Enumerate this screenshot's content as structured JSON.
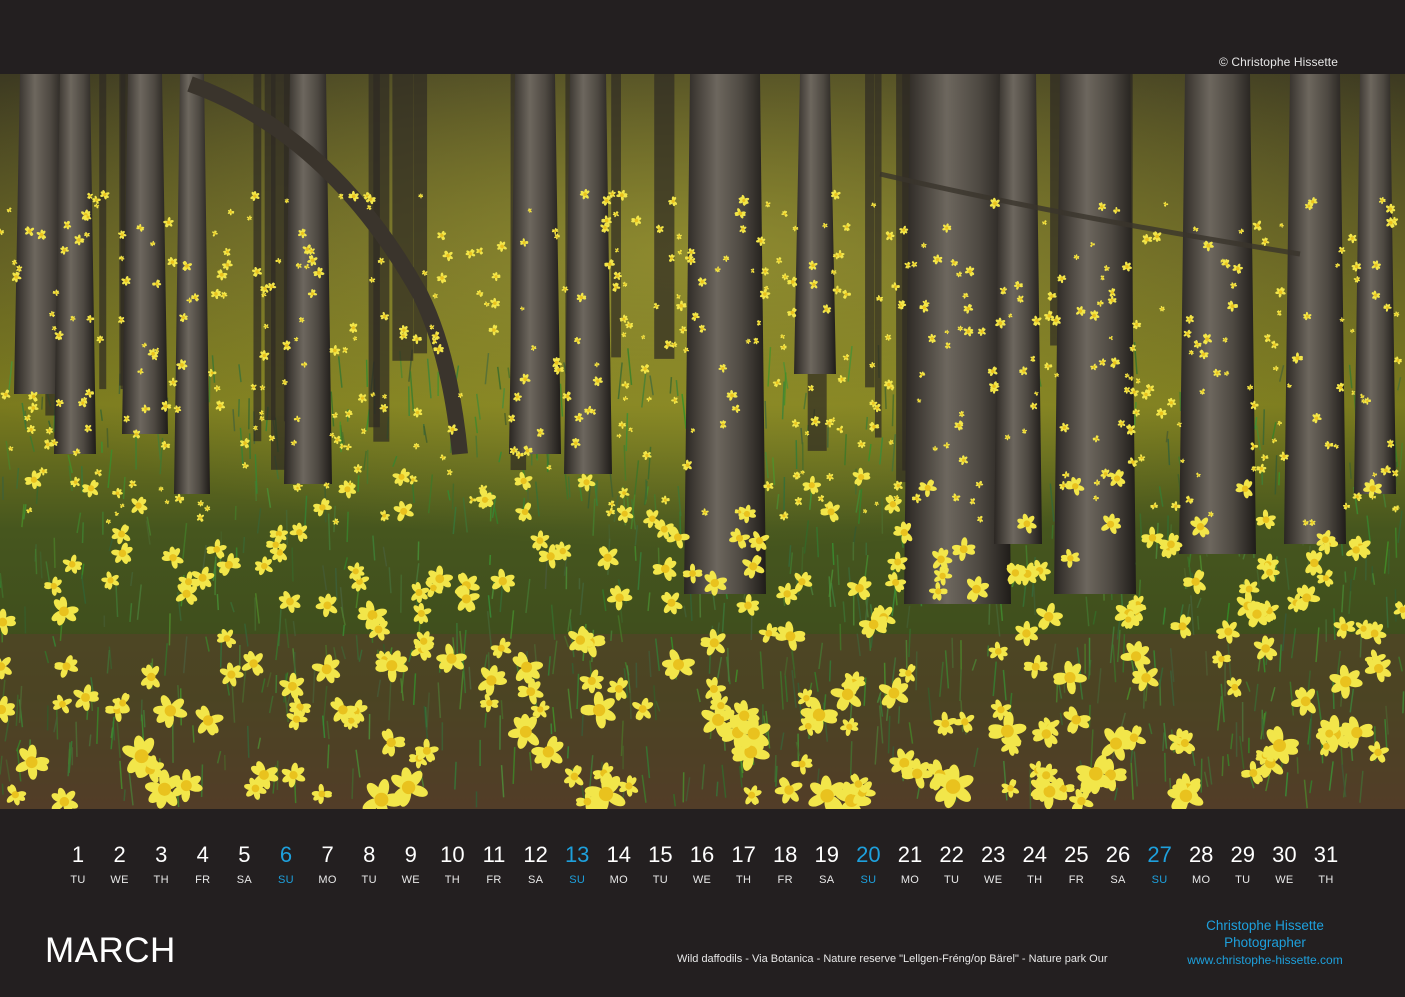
{
  "credit": "© Christophe Hissette",
  "photo": {
    "alt": "Wild daffodils in a forest with tree trunks"
  },
  "month": "MARCH",
  "caption": "Wild daffodils - Via Botanica - Nature reserve \"Lellgen-Fréng/op Bärel\" - Nature park Our",
  "brand": {
    "name": "Christophe Hissette",
    "role": "Photographer",
    "website": "www.christophe-hissette.com"
  },
  "colors": {
    "background": "#231f20",
    "sunday": "#1ea0dc",
    "text": "#ffffff"
  },
  "days": [
    {
      "num": "1",
      "dow": "TU"
    },
    {
      "num": "2",
      "dow": "WE"
    },
    {
      "num": "3",
      "dow": "TH"
    },
    {
      "num": "4",
      "dow": "FR"
    },
    {
      "num": "5",
      "dow": "SA"
    },
    {
      "num": "6",
      "dow": "SU"
    },
    {
      "num": "7",
      "dow": "MO"
    },
    {
      "num": "8",
      "dow": "TU"
    },
    {
      "num": "9",
      "dow": "WE"
    },
    {
      "num": "10",
      "dow": "TH"
    },
    {
      "num": "11",
      "dow": "FR"
    },
    {
      "num": "12",
      "dow": "SA"
    },
    {
      "num": "13",
      "dow": "SU"
    },
    {
      "num": "14",
      "dow": "MO"
    },
    {
      "num": "15",
      "dow": "TU"
    },
    {
      "num": "16",
      "dow": "WE"
    },
    {
      "num": "17",
      "dow": "TH"
    },
    {
      "num": "18",
      "dow": "FR"
    },
    {
      "num": "19",
      "dow": "SA"
    },
    {
      "num": "20",
      "dow": "SU"
    },
    {
      "num": "21",
      "dow": "MO"
    },
    {
      "num": "22",
      "dow": "TU"
    },
    {
      "num": "23",
      "dow": "WE"
    },
    {
      "num": "24",
      "dow": "TH"
    },
    {
      "num": "25",
      "dow": "FR"
    },
    {
      "num": "26",
      "dow": "SA"
    },
    {
      "num": "27",
      "dow": "SU"
    },
    {
      "num": "28",
      "dow": "MO"
    },
    {
      "num": "29",
      "dow": "TU"
    },
    {
      "num": "30",
      "dow": "WE"
    },
    {
      "num": "31",
      "dow": "TH"
    }
  ]
}
